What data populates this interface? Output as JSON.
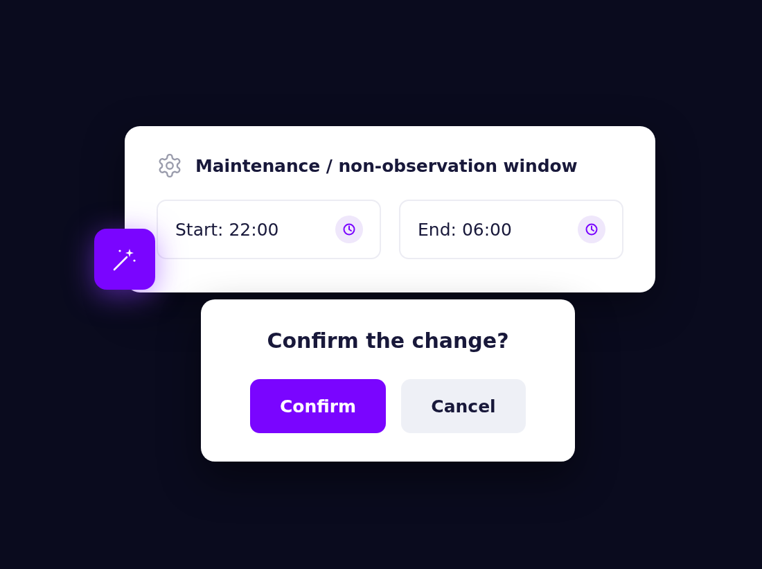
{
  "settings_card": {
    "title": "Maintenance / non-observation window",
    "fields": [
      {
        "value": "Start: 22:00"
      },
      {
        "value": "End: 06:00"
      }
    ]
  },
  "confirm_dialog": {
    "title": "Confirm the change?",
    "buttons": [
      {
        "label": "Confirm",
        "kind": "primary"
      },
      {
        "label": "Cancel",
        "kind": "secondary"
      }
    ]
  }
}
